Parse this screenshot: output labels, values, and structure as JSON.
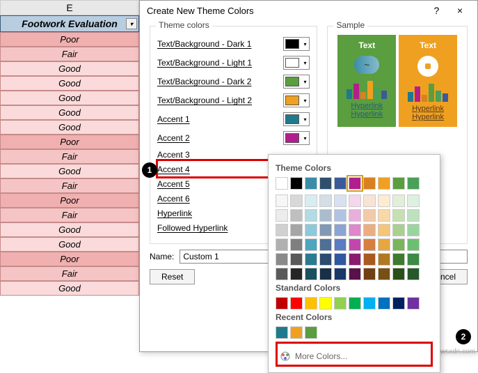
{
  "column_letter": "E",
  "header": "Footwork Evaluation",
  "rows": [
    {
      "v": "Poor",
      "c": "poor"
    },
    {
      "v": "Fair",
      "c": "fair"
    },
    {
      "v": "Good",
      "c": "good"
    },
    {
      "v": "Good",
      "c": "good"
    },
    {
      "v": "Good",
      "c": "good"
    },
    {
      "v": "Good",
      "c": "good"
    },
    {
      "v": "Good",
      "c": "good"
    },
    {
      "v": "Poor",
      "c": "poor"
    },
    {
      "v": "Fair",
      "c": "fair"
    },
    {
      "v": "Good",
      "c": "good"
    },
    {
      "v": "Fair",
      "c": "fair"
    },
    {
      "v": "Poor",
      "c": "poor"
    },
    {
      "v": "Fair",
      "c": "fair"
    },
    {
      "v": "Good",
      "c": "good"
    },
    {
      "v": "Good",
      "c": "good"
    },
    {
      "v": "Poor",
      "c": "poor"
    },
    {
      "v": "Fair",
      "c": "fair"
    },
    {
      "v": "Good",
      "c": "good"
    }
  ],
  "dialog": {
    "title": "Create New Theme Colors",
    "help": "?",
    "close": "×",
    "theme_label": "Theme colors",
    "sample_label": "Sample",
    "items": [
      {
        "label": "Text/Background - Dark 1",
        "color": "#000000"
      },
      {
        "label": "Text/Background - Light 1",
        "color": "#ffffff"
      },
      {
        "label": "Text/Background - Dark 2",
        "color": "#5a9e3f"
      },
      {
        "label": "Text/Background - Light 2",
        "color": "#f0a020"
      },
      {
        "label": "Accent 1",
        "color": "#1f7a8c"
      },
      {
        "label": "Accent 2",
        "color": "#b21f8c"
      },
      {
        "label": "Accent 3",
        "color": ""
      },
      {
        "label": "Accent 4",
        "color": ""
      },
      {
        "label": "Accent 5",
        "color": ""
      },
      {
        "label": "Accent 6",
        "color": ""
      },
      {
        "label": "Hyperlink",
        "color": ""
      },
      {
        "label": "Followed Hyperlink",
        "color": ""
      }
    ],
    "sample": {
      "text": "Text",
      "hyperlink": "Hyperlink"
    },
    "name_label": "Name:",
    "name_value": "Custom 1",
    "reset": "Reset",
    "cancel": "Cancel"
  },
  "picker": {
    "theme_title": "Theme Colors",
    "std_title": "Standard Colors",
    "recent_title": "Recent Colors",
    "more": "More Colors...",
    "theme_main": [
      "#ffffff",
      "#000000",
      "#3a8da8",
      "#2f4f6f",
      "#3a5a9a",
      "#b21f8c",
      "#d98020",
      "#f0a020",
      "#5a9e3f",
      "#4aa058"
    ],
    "theme_tints": [
      [
        "#f6f6f6",
        "#d8d8d8",
        "#d8edf2",
        "#d5dde6",
        "#d8e0f0",
        "#f4d7ed",
        "#f8e4d4",
        "#fbecd2",
        "#e2efd8",
        "#def0df"
      ],
      [
        "#ececec",
        "#bfbfbf",
        "#b2dbe6",
        "#abbccd",
        "#b2c2e2",
        "#e9afdc",
        "#f2c9aa",
        "#f8d9a6",
        "#c6e0b2",
        "#bde2bf"
      ],
      [
        "#d0d0d0",
        "#a6a6a6",
        "#8cc9d9",
        "#8199b4",
        "#8ba4d4",
        "#de87cb",
        "#ebae80",
        "#f4c679",
        "#a9d08e",
        "#9bd49f"
      ],
      [
        "#b0b0b0",
        "#7f7f7f",
        "#4da6bd",
        "#4f6f94",
        "#5a7cc0",
        "#c247ad",
        "#d87f40",
        "#e8a63f",
        "#7ab55c",
        "#6cbf72"
      ],
      [
        "#8a8a8a",
        "#595959",
        "#2a7a90",
        "#2d4c70",
        "#2f58a0",
        "#8a1a70",
        "#a85a20",
        "#b07820",
        "#3f7a2d",
        "#3d8a44"
      ],
      [
        "#5a5a5a",
        "#262626",
        "#1a5060",
        "#182f48",
        "#183868",
        "#5a1048",
        "#704014",
        "#785014",
        "#285018",
        "#265a2a"
      ]
    ],
    "standard": [
      "#c00000",
      "#ff0000",
      "#ffc000",
      "#ffff00",
      "#92d050",
      "#00b050",
      "#00b0f0",
      "#0070c0",
      "#002060",
      "#7030a0"
    ],
    "recent": [
      "#1f7a8c",
      "#f0a020",
      "#5a9e3f"
    ],
    "selected_index": 5
  },
  "watermark": "wsxdn.com"
}
